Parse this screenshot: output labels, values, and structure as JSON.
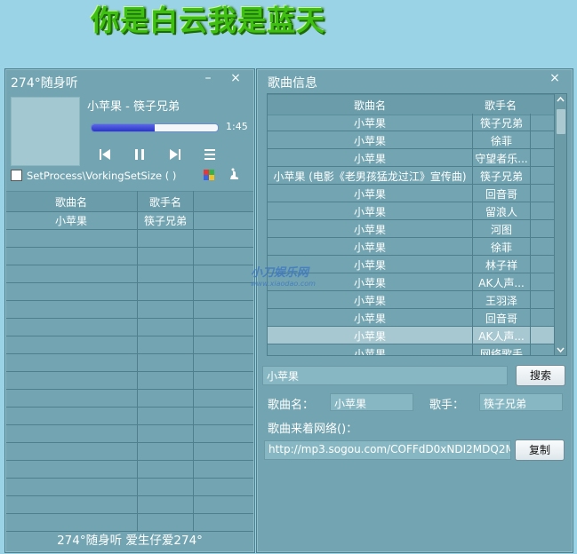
{
  "banner": {
    "text": "你是白云我是蓝天"
  },
  "player": {
    "title": "274°随身听",
    "minimize_label": "–",
    "close_label": "×",
    "now_playing": "小苹果 - 筷子兄弟",
    "progress": 0.5,
    "time": "1:45",
    "checkbox_label": "SetProcess\\VorkingSetSize ( )"
  },
  "playlist": {
    "columns": [
      "歌曲名",
      "歌手名"
    ],
    "rows": [
      [
        "小苹果",
        "筷子兄弟"
      ]
    ]
  },
  "footer": {
    "text": "274°随身听  爱生仔爱274°"
  },
  "info_panel": {
    "title": "歌曲信息",
    "close_label": "×",
    "columns": [
      "歌曲名",
      "歌手名"
    ],
    "rows": [
      [
        "小苹果",
        "筷子兄弟"
      ],
      [
        "小苹果",
        "徐菲"
      ],
      [
        "小苹果",
        "守望者乐..."
      ],
      [
        "小苹果 (电影《老男孩猛龙过江》宣传曲)",
        "筷子兄弟"
      ],
      [
        "小苹果",
        "回音哥"
      ],
      [
        "小苹果",
        "留浪人"
      ],
      [
        "小苹果",
        "河图"
      ],
      [
        "小苹果",
        "徐菲"
      ],
      [
        "小苹果",
        "林子祥"
      ],
      [
        "小苹果",
        "AK人声..."
      ],
      [
        "小苹果",
        "王羽泽"
      ],
      [
        "小苹果",
        "回音哥"
      ],
      [
        "小苹果",
        "AK人声..."
      ],
      [
        "小苹果",
        "网络歌手"
      ]
    ],
    "selected_index": 12,
    "search_value": "小苹果",
    "search_button": "搜索",
    "song_label": "歌曲名：",
    "song_value": "小苹果",
    "singer_label": "歌手：",
    "singer_value": "筷子兄弟",
    "source_label": "歌曲来着网络()：",
    "url_value": "http://mp3.sogou.com/COFFdD0xNDI2MDQ2M",
    "copy_button": "复制"
  },
  "watermark": {
    "text": "小刀娱乐网",
    "sub": "www.xiaodao.com"
  }
}
